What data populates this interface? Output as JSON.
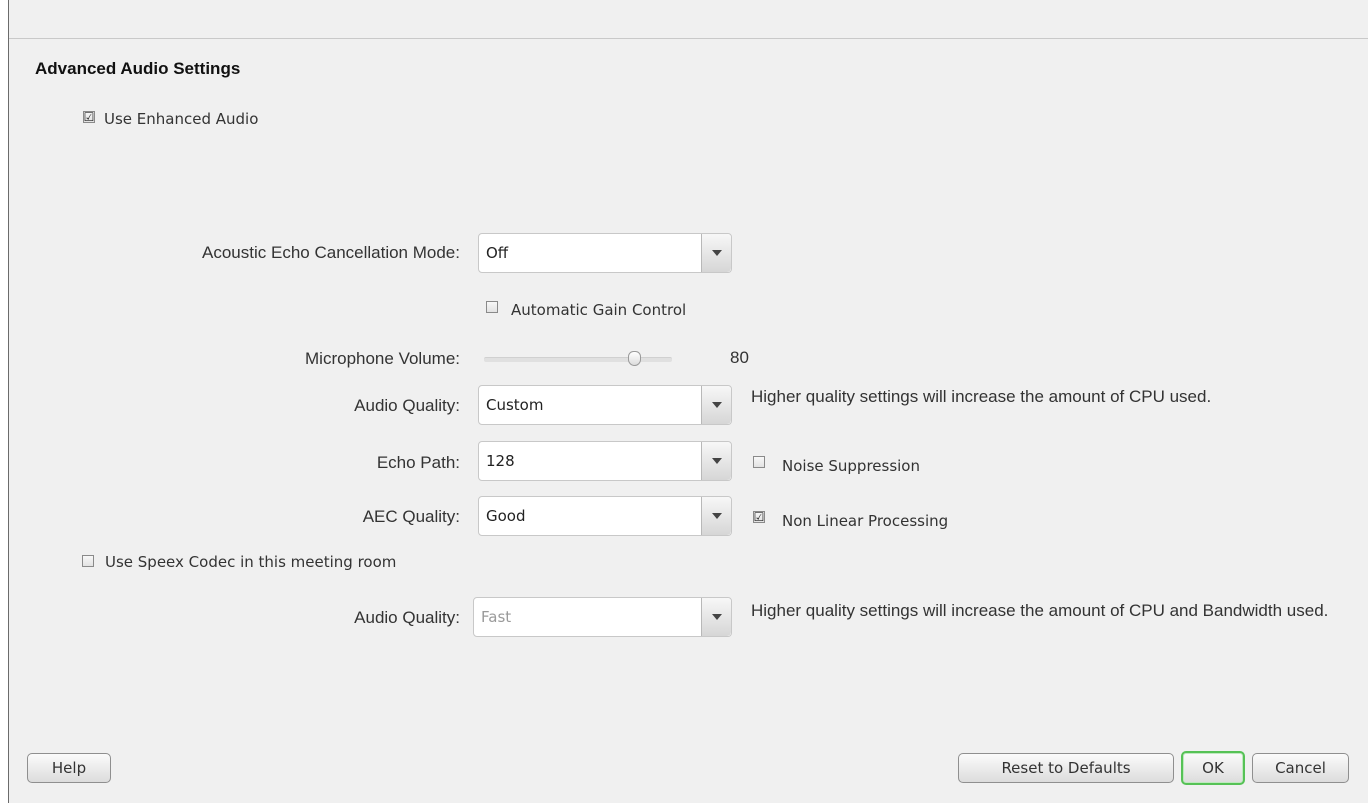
{
  "dialog": {
    "title": "Advanced Audio Settings",
    "use_enhanced_audio": {
      "label": "Use Enhanced Audio",
      "checked": "☑"
    },
    "aec_mode": {
      "label": "Acoustic Echo Cancellation Mode:",
      "value": "Off"
    },
    "agc": {
      "label": "Automatic Gain Control",
      "checked": ""
    },
    "mic_volume": {
      "label": "Microphone Volume:",
      "value": "80",
      "level_fraction": 0.8
    },
    "audio_quality": {
      "label": "Audio Quality:",
      "value": "Custom",
      "note": "Higher quality settings will increase the amount of CPU used."
    },
    "echo_path": {
      "label": "Echo Path:",
      "value": "128"
    },
    "noise_suppression": {
      "label": "Noise Suppression",
      "checked": ""
    },
    "aec_quality": {
      "label": "AEC Quality:",
      "value": "Good"
    },
    "non_linear_processing": {
      "label": "Non Linear Processing",
      "checked": "☑"
    },
    "speex": {
      "label": "Use Speex Codec in this meeting room",
      "checked": ""
    },
    "speex_quality": {
      "label": "Audio Quality:",
      "value": "Fast",
      "note": "Higher quality settings will increase the amount of CPU and Bandwidth used."
    }
  },
  "buttons": {
    "help": "Help",
    "reset": "Reset to Defaults",
    "ok": "OK",
    "cancel": "Cancel"
  },
  "icons": {
    "dropdown": "chevron-down-icon",
    "checkmark": "check-icon"
  },
  "colors": {
    "ok_border": "#56c256",
    "background": "#f0f0f0"
  }
}
